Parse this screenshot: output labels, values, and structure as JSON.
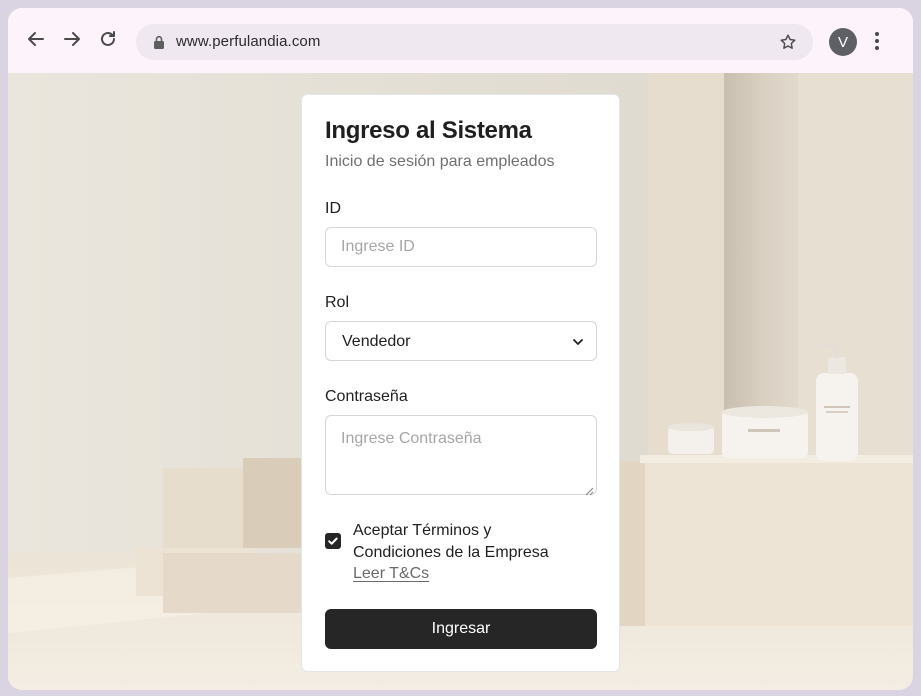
{
  "browser": {
    "url": "www.perfulandia.com",
    "profile_initial": "V"
  },
  "login": {
    "title": "Ingreso al Sistema",
    "subtitle": "Inicio de sesión para empleados",
    "id_label": "ID",
    "id_placeholder": "Ingrese ID",
    "role_label": "Rol",
    "role_value": "Vendedor",
    "password_label": "Contraseña",
    "password_placeholder": "Ingrese Contraseña",
    "terms_text": "Aceptar Términos y Condiciones de la Empresa",
    "terms_checked": true,
    "terms_link": "Leer T&Cs",
    "submit_label": "Ingresar"
  }
}
